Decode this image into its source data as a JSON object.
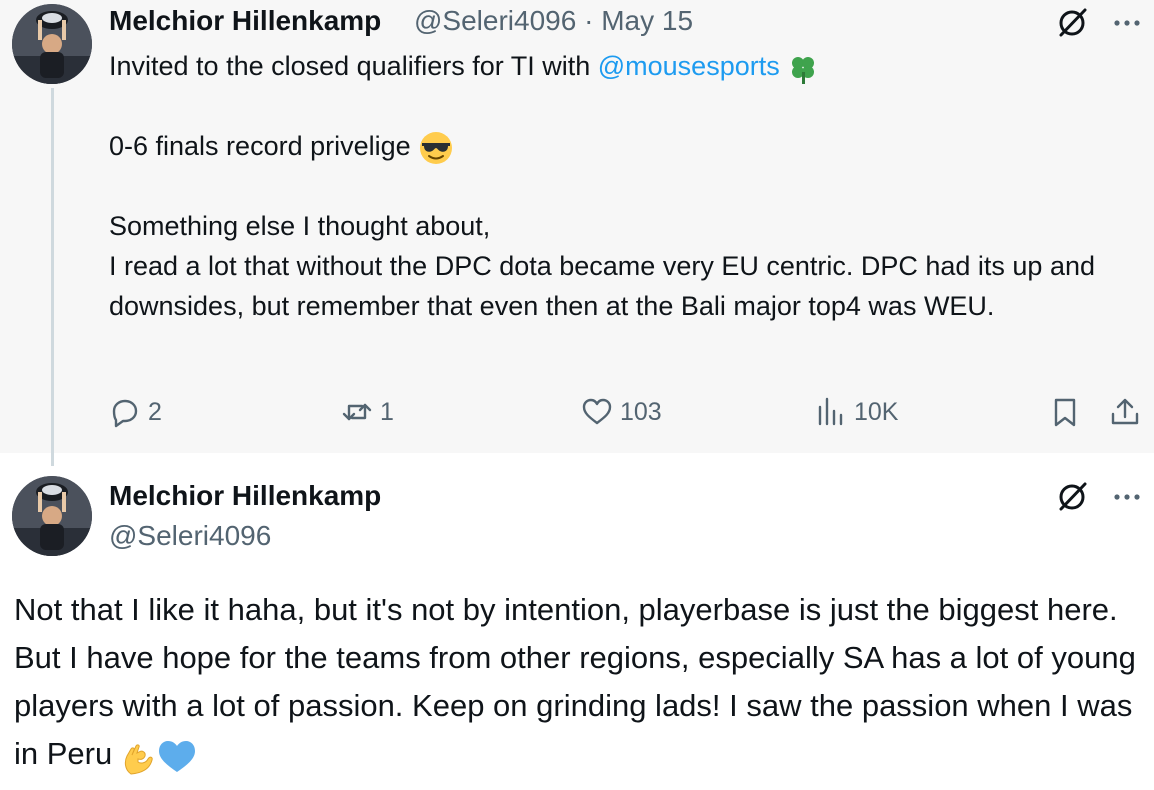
{
  "reply_tweet": {
    "author_name": "Melchior Hillenkamp",
    "handle": "@Seleri4096",
    "separator": "·",
    "date": "May 15",
    "text_line1_before": "Invited to the closed qualifiers for TI with ",
    "mention": "@mousesports",
    "text_line1_emoji": "shamrock",
    "text_para2": "0-6 finals record privelige",
    "text_para2_emoji": "sunglasses-face",
    "text_para3": "Something else I thought about,\nI read a lot that without the DPC dota became very EU centric. DPC had its up and downsides, but remember that even then at the Bali major top4 was WEU.",
    "actions": {
      "replies": "2",
      "reposts": "1",
      "likes": "103",
      "views": "10K"
    }
  },
  "main_tweet": {
    "author_name": "Melchior Hillenkamp",
    "handle": "@Seleri4096",
    "text": "Not that I like it haha, but it's not by intention, playerbase is just the biggest here. But I have hope for the teams from other regions, especially SA has a lot of young players with a lot of passion. Keep on grinding lads! I saw the passion when I was in Peru ",
    "emojis": [
      "ok-hand",
      "blue-heart"
    ]
  },
  "colors": {
    "accent": "#1d9bf0",
    "secondary_text": "#536471",
    "thread_line": "#cfd9de",
    "reply_background": "#f7f7f7"
  }
}
